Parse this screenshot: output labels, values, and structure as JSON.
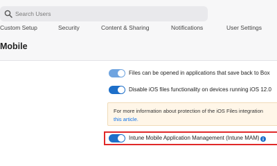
{
  "search": {
    "placeholder": "Search Users"
  },
  "tabs": [
    {
      "label": "Custom Setup"
    },
    {
      "label": "Security"
    },
    {
      "label": "Content & Sharing"
    },
    {
      "label": "Notifications"
    },
    {
      "label": "User Settings"
    }
  ],
  "page": {
    "title": "Mobile"
  },
  "settings": [
    {
      "label": "Files can be opened in applications that save back to Box",
      "enabled": true,
      "state": "on-light"
    },
    {
      "label": "Disable iOS files functionality on devices running iOS 12.0",
      "enabled": true,
      "state": "on"
    },
    {
      "label": "Intune Mobile Application Management (Intune MAM)",
      "enabled": true,
      "state": "on"
    }
  ],
  "info_box": {
    "text": "For more information about protection of the iOS Files integration",
    "link": "this article."
  },
  "colors": {
    "accent": "#0e72ed",
    "toggle_on": "#1d6fc9",
    "toggle_on_light": "#6fa4e0",
    "highlight": "#e02828",
    "info_bg": "#fff6e8"
  },
  "icons": {
    "search": "search-icon",
    "info": "info-icon"
  }
}
